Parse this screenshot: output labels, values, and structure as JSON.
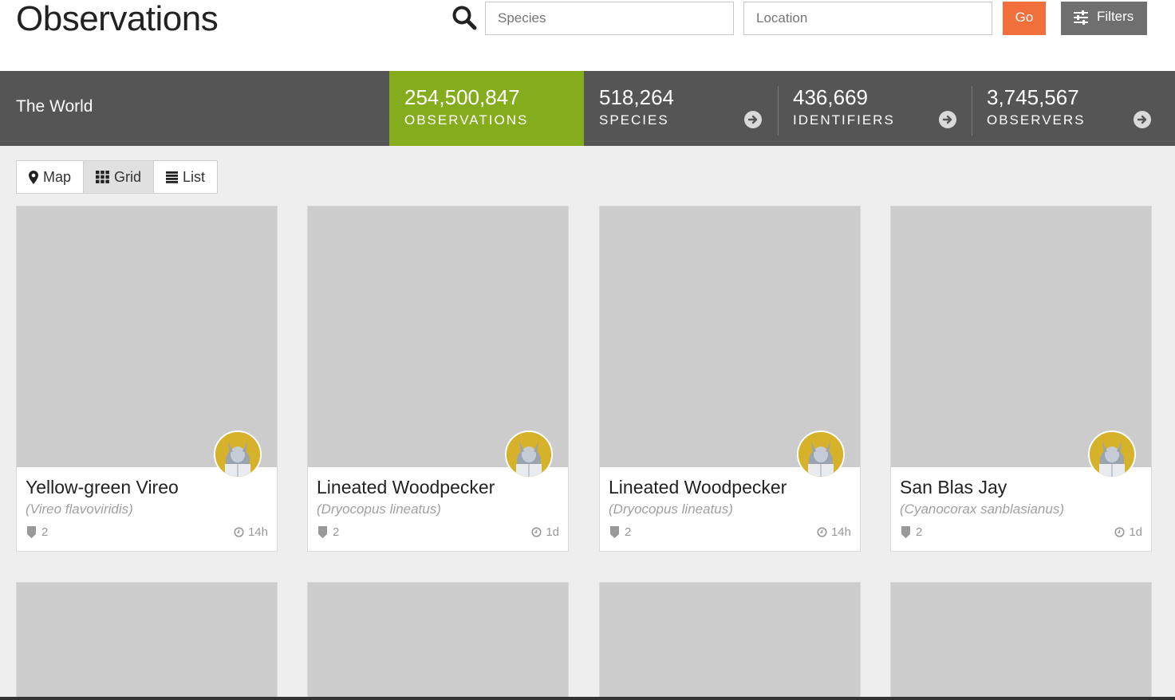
{
  "header": {
    "title": "Observations",
    "species_placeholder": "Species",
    "location_placeholder": "Location",
    "go_label": "Go",
    "filters_label": "Filters"
  },
  "stats": {
    "place": "The World",
    "items": [
      {
        "value": "254,500,847",
        "label": "OBSERVATIONS"
      },
      {
        "value": "518,264",
        "label": "SPECIES"
      },
      {
        "value": "436,669",
        "label": "IDENTIFIERS"
      },
      {
        "value": "3,745,567",
        "label": "OBSERVERS"
      }
    ]
  },
  "view_toggle": {
    "map": "Map",
    "grid": "Grid",
    "list": "List",
    "active": "grid"
  },
  "colors": {
    "accent_green": "#85ac1c",
    "go_orange": "#f16f3a",
    "stats_bg": "#555555"
  },
  "cards": [
    {
      "common_name": "Yellow-green Vireo",
      "scientific_name": "(Vireo flavoviridis)",
      "id_count": "2",
      "time_ago": "14h"
    },
    {
      "common_name": "Lineated Woodpecker",
      "scientific_name": "(Dryocopus lineatus)",
      "id_count": "2",
      "time_ago": "1d"
    },
    {
      "common_name": "Lineated Woodpecker",
      "scientific_name": "(Dryocopus lineatus)",
      "id_count": "2",
      "time_ago": "14h"
    },
    {
      "common_name": "San Blas Jay",
      "scientific_name": "(Cyanocorax sanblasianus)",
      "id_count": "2",
      "time_ago": "1d"
    }
  ]
}
